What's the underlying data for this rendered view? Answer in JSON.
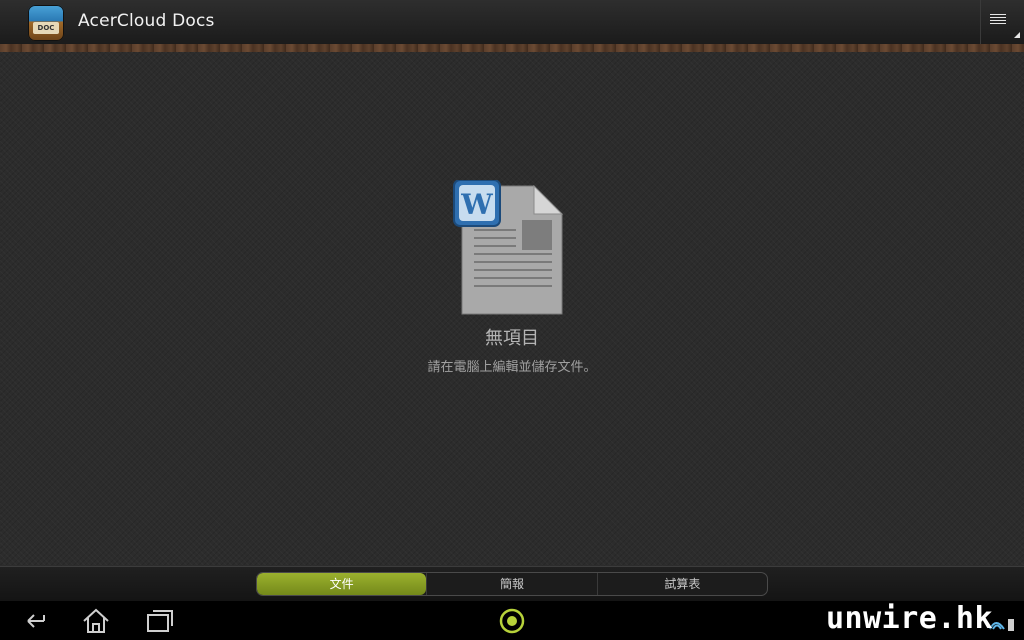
{
  "app": {
    "title": "AcerCloud Docs",
    "icon_label": "DOC"
  },
  "empty_state": {
    "title": "無項目",
    "subtitle": "請在電腦上編輯並儲存文件。",
    "icon": "word-document-icon"
  },
  "tabs": [
    {
      "label": "文件",
      "active": true
    },
    {
      "label": "簡報",
      "active": false
    },
    {
      "label": "試算表",
      "active": false
    }
  ],
  "system_bar": {
    "watermark": "unwire.hk"
  },
  "colors": {
    "accent": "#8aa123",
    "background": "#2c2c2c",
    "word_blue": "#3f7fc0"
  }
}
